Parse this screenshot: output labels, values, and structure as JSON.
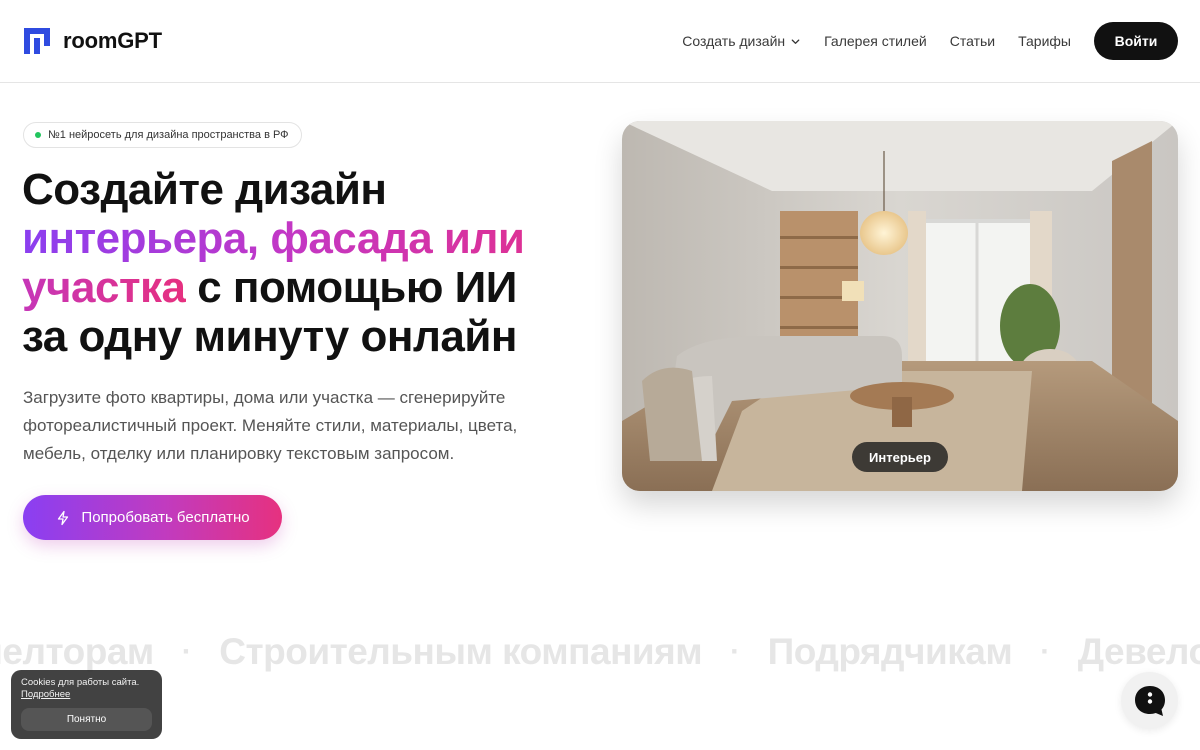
{
  "header": {
    "brand": "roomGPT",
    "nav": [
      {
        "label": "Создать дизайн",
        "has_dropdown": true
      },
      {
        "label": "Галерея стилей"
      },
      {
        "label": "Статьи"
      },
      {
        "label": "Тарифы"
      }
    ],
    "login_label": "Войти"
  },
  "hero": {
    "badge": "№1 нейросеть для дизайна пространства в РФ",
    "headline": {
      "line1": "Создайте дизайн",
      "line2": "интерьера, фасада или",
      "line3_gradient": "участка",
      "line3_rest": " с помощью ИИ",
      "line4": "за одну минуту онлайн"
    },
    "description": "Загрузите фото квартиры, дома или участка — сгенерируйте фотореалистичный проект. Меняйте стили, материалы, цвета, мебель, отделку или планировку текстовым запросом.",
    "cta_label": "Попробовать бесплатно",
    "image_label": "Интерьер"
  },
  "marquee": {
    "items": [
      "Риелторам",
      "Строительным компаниям",
      "Подрядчикам",
      "Девелоперам"
    ],
    "separator": "·"
  },
  "cookie": {
    "text": "Cookies для работы сайта.",
    "link": "Подробнее",
    "button": "Понятно"
  },
  "colors": {
    "accent_purple": "#8b3ff0",
    "accent_pink": "#e62f86",
    "dark": "#111111"
  },
  "icons": [
    "logo-icon",
    "chevron-down-icon",
    "lightning-icon",
    "chat-icon"
  ]
}
